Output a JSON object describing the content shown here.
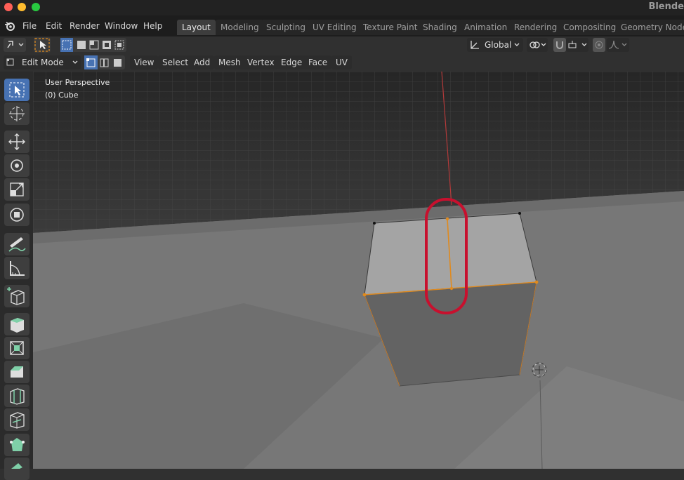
{
  "window": {
    "app_title": "Blende"
  },
  "menu": {
    "items": [
      "File",
      "Edit",
      "Render",
      "Window",
      "Help"
    ]
  },
  "workspaces": {
    "tabs": [
      "Layout",
      "Modeling",
      "Sculpting",
      "UV Editing",
      "Texture Paint",
      "Shading",
      "Animation",
      "Rendering",
      "Compositing",
      "Geometry Nodes"
    ],
    "active": "Layout"
  },
  "header": {
    "mode": "Edit Mode",
    "orientation": "Global",
    "menus": [
      "View",
      "Select",
      "Add",
      "Mesh",
      "Vertex",
      "Edge",
      "Face",
      "UV"
    ]
  },
  "viewport": {
    "perspective": "User Perspective",
    "object": "(0) Cube"
  },
  "tools": [
    "select-box-icon",
    "cursor-icon",
    "move-icon",
    "rotate-icon",
    "scale-icon",
    "transform-icon",
    "annotate-icon",
    "measure-icon",
    "add-cube-icon",
    "extrude-icon",
    "inset-icon",
    "bevel-icon",
    "loop-cut-icon",
    "knife-icon",
    "poly-build-icon",
    "spin-icon"
  ],
  "colors": {
    "accent": "#4772b3",
    "edge_highlight": "#e08a1e",
    "annotation": "#c8102e",
    "x_axis": "#b33a3a"
  }
}
